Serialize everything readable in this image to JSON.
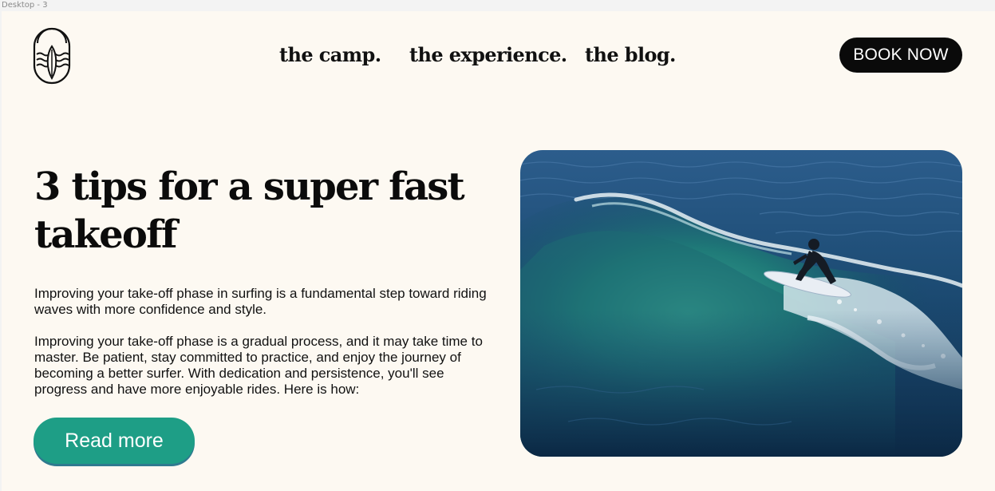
{
  "window": {
    "frame_label": "Desktop - 3"
  },
  "header": {
    "logo_icon": "surf-camp-logo-icon",
    "nav": [
      {
        "label": "the camp."
      },
      {
        "label": "the experience."
      },
      {
        "label": "the blog."
      }
    ],
    "book_button": "BOOK NOW"
  },
  "article": {
    "title": "3 tips for a super fast takeoff",
    "paragraphs": [
      "Improving your take-off phase in surfing is a fundamental step toward riding waves with more confidence and style.",
      "Improving your take-off phase is a gradual process, and it may take time to master. Be patient, stay committed to practice, and enjoy the journey of becoming a better surfer. With dedication and persistence, you'll see progress and have more enjoyable rides. Here is how:"
    ],
    "read_more": "Read more"
  },
  "hero_image": {
    "subject": "surfer-riding-wave-photo"
  },
  "colors": {
    "page_background": "#fdf9f2",
    "primary_text": "#111111",
    "book_button": "#0a0a0a",
    "accent_teal": "#1e9e86"
  }
}
